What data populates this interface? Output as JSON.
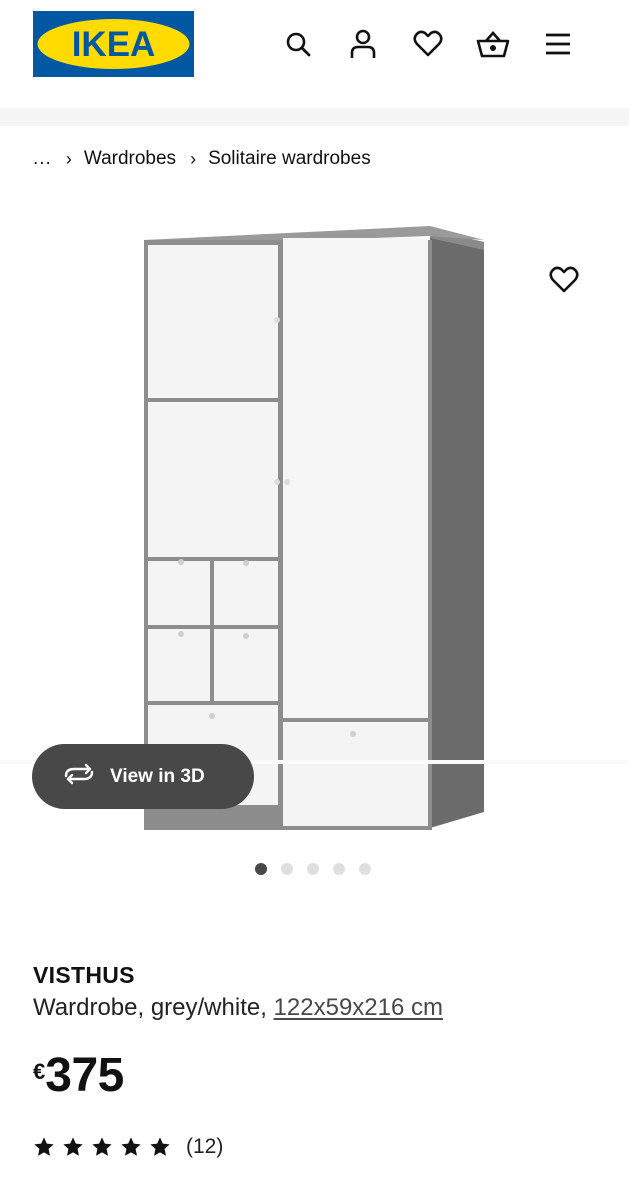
{
  "header": {
    "logo_text": "IKEA",
    "icons": [
      "search-icon",
      "account-icon",
      "heart-icon",
      "basket-icon",
      "menu-icon"
    ]
  },
  "breadcrumb": {
    "ellipsis": "...",
    "items": [
      "Wardrobes",
      "Solitaire wardrobes"
    ]
  },
  "gallery": {
    "view3d_label": "View in 3D",
    "dot_count": 5,
    "active_dot": 1
  },
  "product": {
    "name": "VISTHUS",
    "description": "Wardrobe, grey/white, ",
    "dimensions": "122x59x216 cm",
    "currency": "€",
    "price": "375",
    "rating_value": 5,
    "rating_max": 5,
    "review_count": "(12)"
  },
  "colors": {
    "brand_blue": "#0058a3",
    "brand_yellow": "#ffdb00",
    "button_dark": "#484848"
  }
}
